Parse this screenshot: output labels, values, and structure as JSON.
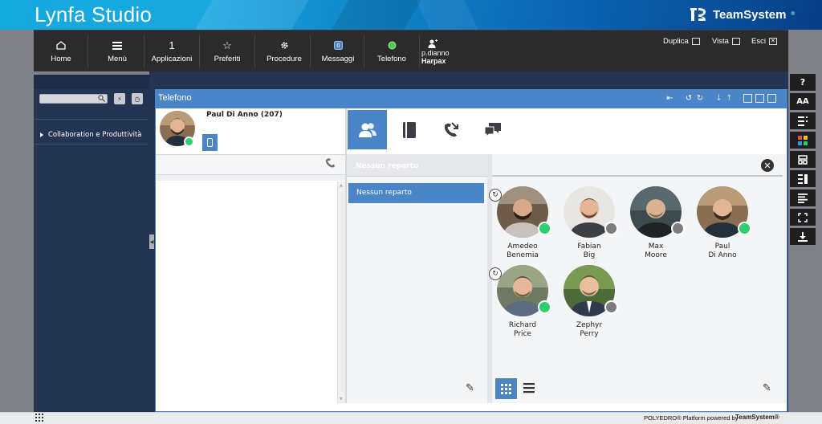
{
  "app": {
    "title": "Lynfa Studio",
    "brand": "TeamSystem",
    "brand_mark": "®"
  },
  "toolbar": {
    "items": [
      {
        "label": "Home",
        "icon": "home-icon",
        "glyph": "⌂"
      },
      {
        "label": "Menù",
        "icon": "menu-icon",
        "glyph": "☰"
      },
      {
        "label": "Applicazioni",
        "icon": "applications-count",
        "glyph": "1"
      },
      {
        "label": "Preferiti",
        "icon": "star-icon",
        "glyph": "☆"
      },
      {
        "label": "Procedure",
        "icon": "gear-icon",
        "glyph": "✱"
      },
      {
        "label": "Messaggi",
        "icon": "message-icon",
        "glyph": ""
      },
      {
        "label": "Telefono",
        "icon": "phone-status-icon",
        "glyph": ""
      }
    ],
    "user": {
      "name": "p.dianno",
      "company": "Harpax"
    },
    "actions": {
      "duplica": "Duplica",
      "vista": "Vista",
      "esci": "Esci"
    }
  },
  "sidebar": {
    "item": "Collaboration e Produttività"
  },
  "window": {
    "title": "Telefono"
  },
  "profile": {
    "name": "Paul Di Anno (207)",
    "status": "online"
  },
  "departments": {
    "header": "Nessun reparto",
    "items": [
      "Nessun reparto"
    ]
  },
  "users": [
    {
      "first": "Amedeo",
      "last": "Benemia",
      "status": "online",
      "forwarding": true
    },
    {
      "first": "Fabian",
      "last": "Big",
      "status": "offline",
      "forwarding": false
    },
    {
      "first": "Max",
      "last": "Moore",
      "status": "offline",
      "forwarding": false
    },
    {
      "first": "Paul",
      "last": "Di Anno",
      "status": "online",
      "forwarding": false
    },
    {
      "first": "Richard",
      "last": "Price",
      "status": "online",
      "forwarding": true
    },
    {
      "first": "Zephyr",
      "last": "Perry",
      "status": "offline",
      "forwarding": false
    }
  ],
  "rightbar": {
    "help": "?",
    "font": "AA"
  },
  "footer": {
    "text": "POLYEDRO® Platform powered by",
    "brand": "TeamSystem®"
  },
  "colors": {
    "accent": "#4a86c7",
    "online": "#2cd16e",
    "offline": "#7d7d7d",
    "navy": "#243553",
    "toolbar": "#2b2b2b"
  }
}
